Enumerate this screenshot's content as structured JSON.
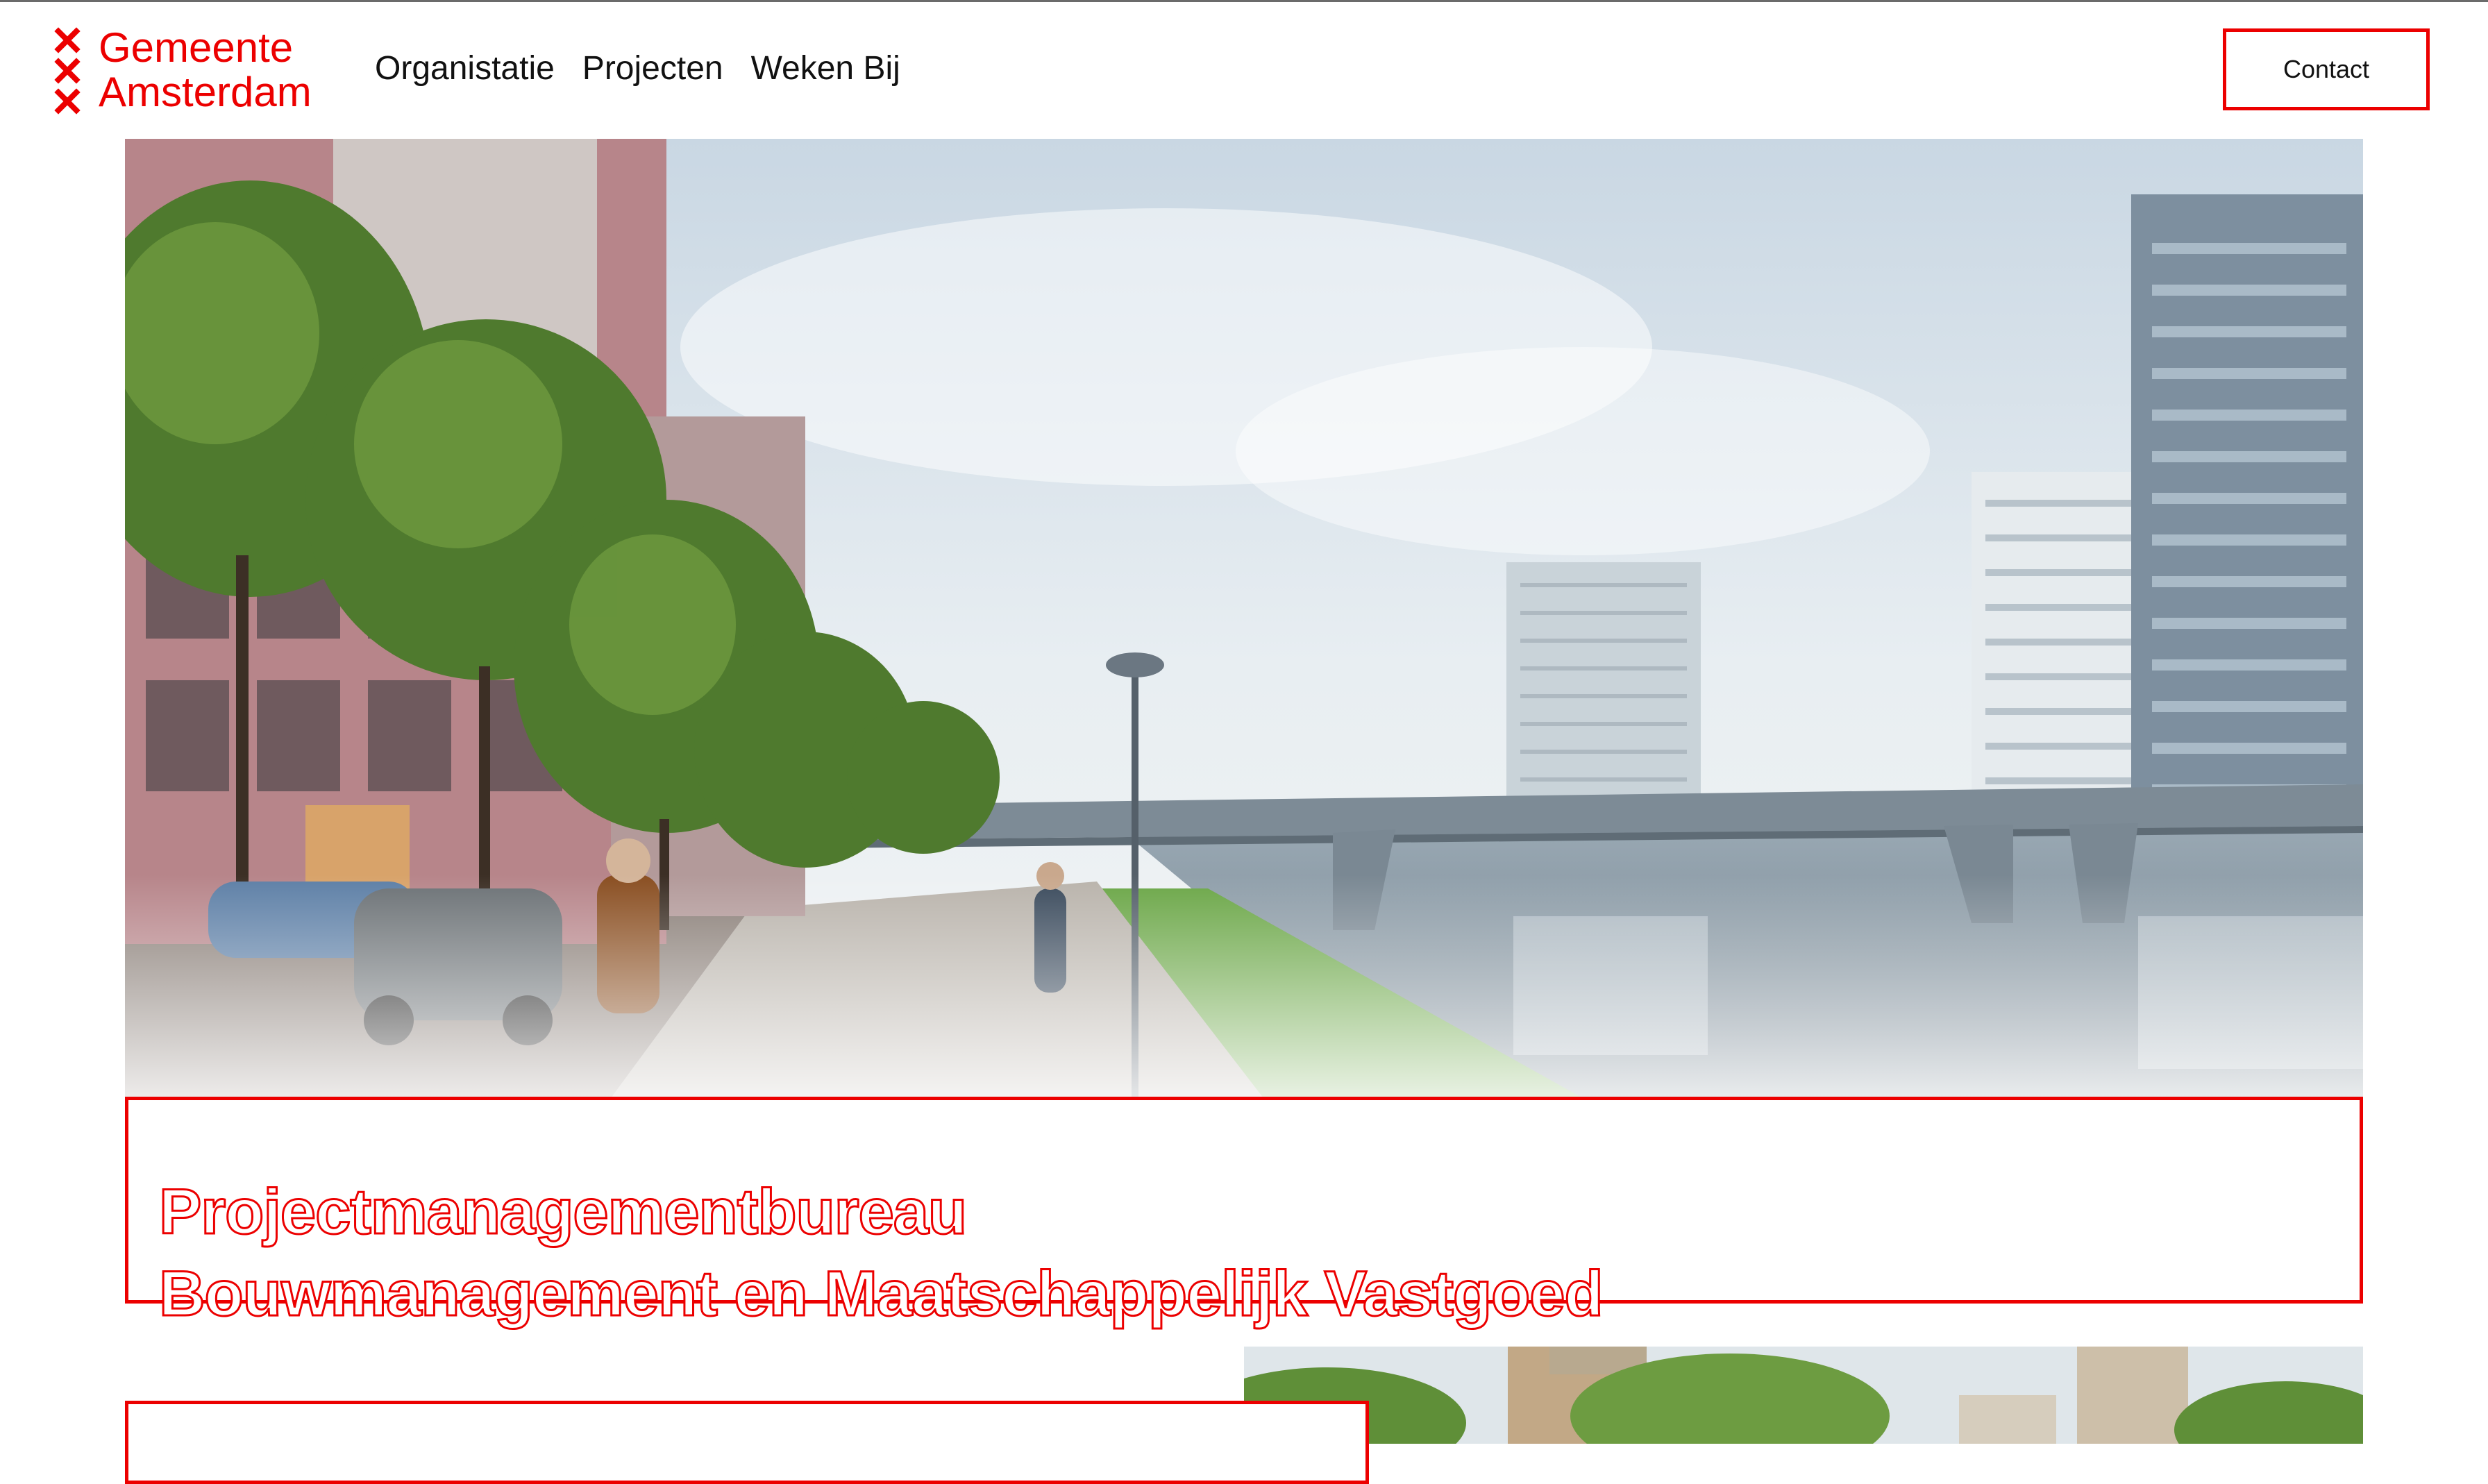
{
  "header": {
    "logo": {
      "line1": "Gemeente",
      "line2": "Amsterdam",
      "icon": "xxx-crosses-icon",
      "color": "#ec0000"
    },
    "nav": [
      {
        "label": "Organistatie"
      },
      {
        "label": "Projecten"
      },
      {
        "label": "Weken Bij"
      }
    ],
    "contact_label": "Contact"
  },
  "hero": {
    "title_line1": "Projectmanagementbureau",
    "title_line2": "Bouwmanagement en Maatschappelijk Vastgoed",
    "accent_color": "#ec0000"
  }
}
